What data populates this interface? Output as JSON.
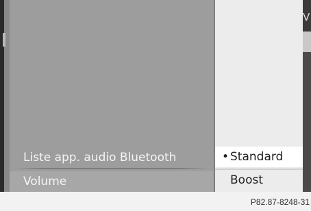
{
  "menu": {
    "items": [
      {
        "label": "Liste app. audio Bluetooth"
      },
      {
        "label": "Volume"
      }
    ],
    "selected_item": "Volume"
  },
  "options": {
    "items": [
      {
        "label": "Standard",
        "bullet": "•",
        "active": true
      },
      {
        "label": "Boost",
        "bullet": "",
        "active": false
      }
    ]
  },
  "edge_fragment": "V",
  "figure_ref": "P82.87-8248-31",
  "colors": {
    "screen_bg": "#9b9b9b",
    "options_bg": "#ececec",
    "text_light": "#f4f4f4",
    "text_dark": "#1f1f1f"
  }
}
